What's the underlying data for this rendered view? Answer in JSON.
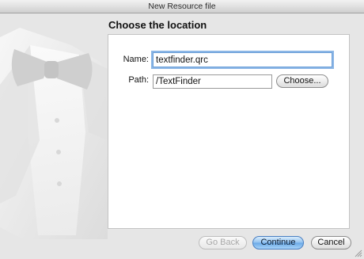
{
  "window": {
    "title": "New Resource file"
  },
  "page": {
    "heading": "Choose the location"
  },
  "form": {
    "name_label": "Name:",
    "name_value": "textfinder.qrc",
    "path_label": "Path:",
    "path_value": "/TextFinder",
    "choose_label": "Choose..."
  },
  "buttons": {
    "back_label": "Go Back",
    "continue_label": "Continue",
    "cancel_label": "Cancel"
  },
  "icons": {
    "watermark": "tuxedo-bowtie-watermark",
    "resize": "resize-grip-icon"
  },
  "colors": {
    "accent": "#6aa8e6",
    "focus_ring": "#8bb6e6"
  }
}
